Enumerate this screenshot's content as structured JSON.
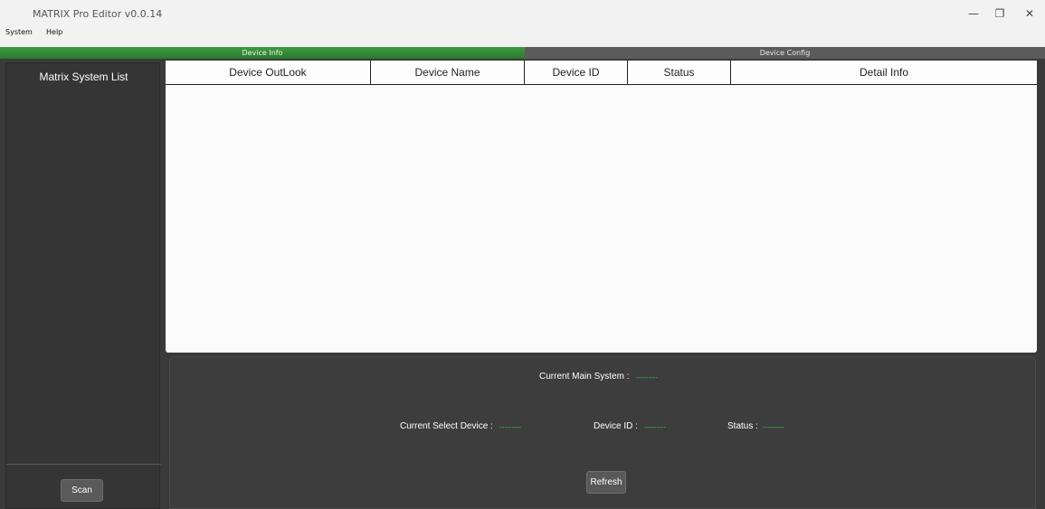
{
  "app": {
    "title": "MATRIX Pro Editor v0.0.14"
  },
  "window_controls": {
    "minimize": "—",
    "restore": "❐",
    "close": "✕"
  },
  "menu": {
    "items": [
      "System",
      "Help"
    ]
  },
  "tabs": [
    {
      "label": "Device Info",
      "active": true
    },
    {
      "label": "Device Config",
      "active": false
    }
  ],
  "sidebar": {
    "title": "Matrix System List",
    "scan_label": "Scan"
  },
  "table": {
    "columns": [
      "Device OutLook",
      "Device Name",
      "Device ID",
      "Status",
      "Detail Info"
    ],
    "rows": []
  },
  "panel": {
    "main_system_label": "Current Main System :",
    "main_system_value": "---------",
    "select_device_label": "Current Select Device :",
    "select_device_value": "---------",
    "device_id_label": "Device ID :",
    "device_id_value": "---------",
    "status_label": "Status :",
    "status_value": "---------",
    "refresh_label": "Refresh"
  },
  "colors": {
    "accent": "#2e8b32",
    "value_text": "#3ad04a",
    "panel_bg": "#3d3d3d"
  }
}
